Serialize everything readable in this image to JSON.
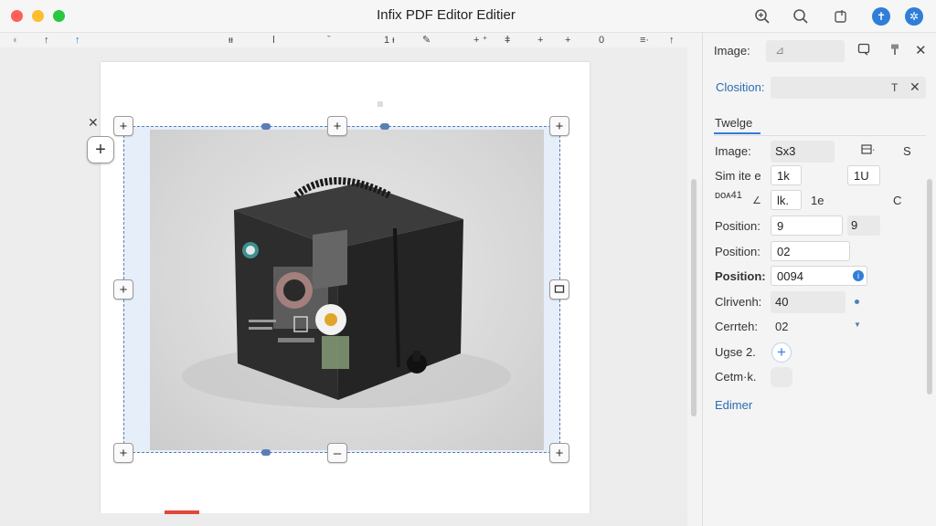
{
  "window": {
    "title": "Infix PDF Editor Editier"
  },
  "toolbar": {
    "items": [
      {
        "label": "↑"
      },
      {
        "label": "↑"
      },
      {
        "label": "ᵻᵻ"
      },
      {
        "label": "ǀ"
      },
      {
        "label": "ˉ"
      },
      {
        "label": "1 ᵻ"
      },
      {
        "label": "✎"
      },
      {
        "label": "+ ⁺"
      },
      {
        "label": "ǂ"
      },
      {
        "label": "+"
      },
      {
        "label": "+"
      },
      {
        "label": "0"
      },
      {
        "label": "≡·"
      },
      {
        "label": "↑"
      }
    ]
  },
  "panel": {
    "image_label": "Image:",
    "image_field_value": "⊿",
    "position_heading": "Closition:",
    "position_heading_icon": "T",
    "tab_label": "Twelge",
    "rows": [
      {
        "label": "Image:",
        "value": "Sx3",
        "extra": "S"
      },
      {
        "label": "Sim ite e",
        "value": "1k",
        "extra_value": "1U"
      },
      {
        "label": "ᴅᴏᴀ41",
        "value": "lk.",
        "extra": "1e",
        "extra2": "C"
      },
      {
        "label": "Position:",
        "value": "9",
        "extra_value": "9"
      },
      {
        "label": "Position:",
        "value": "02"
      },
      {
        "label": "Position:",
        "value": "0094"
      },
      {
        "label": "Clrivenh:",
        "value": "40"
      },
      {
        "label": "Cerrteh:",
        "value": "02"
      },
      {
        "label": "Ugse 2."
      },
      {
        "label": "Cetm·k."
      }
    ],
    "link": "Edimer"
  },
  "icons": {
    "zoom": "zoom-in-icon",
    "search": "search-icon",
    "share": "share-icon",
    "accessibility": "accessibility-icon",
    "settings": "settings-icon"
  },
  "colors": {
    "accent": "#2f7ed8",
    "selection_border": "#5a7fb5"
  }
}
